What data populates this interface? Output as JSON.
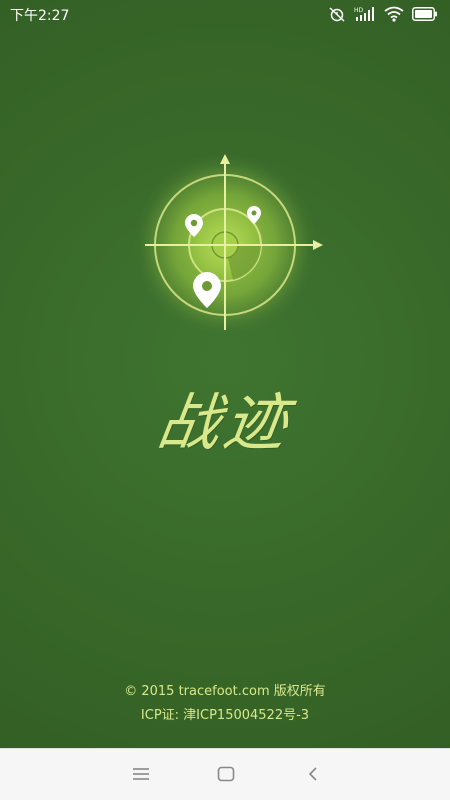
{
  "status_bar": {
    "time": "下午2:27",
    "icons": [
      "alarm-off-icon",
      "signal-hd-icon",
      "wifi-icon",
      "battery-icon"
    ]
  },
  "app": {
    "title": "战迹",
    "logo_icon": "radar-map-pin-icon"
  },
  "footer": {
    "copyright": "© 2015 tracefoot.com 版权所有",
    "icp": "ICP证: 津ICP15004522号-3"
  },
  "nav_bar": {
    "buttons": [
      "menu-icon",
      "home-icon",
      "back-icon"
    ]
  },
  "colors": {
    "background": "#3a6a2a",
    "accent": "#d8e88a",
    "nav_background": "#f6f6f6"
  }
}
